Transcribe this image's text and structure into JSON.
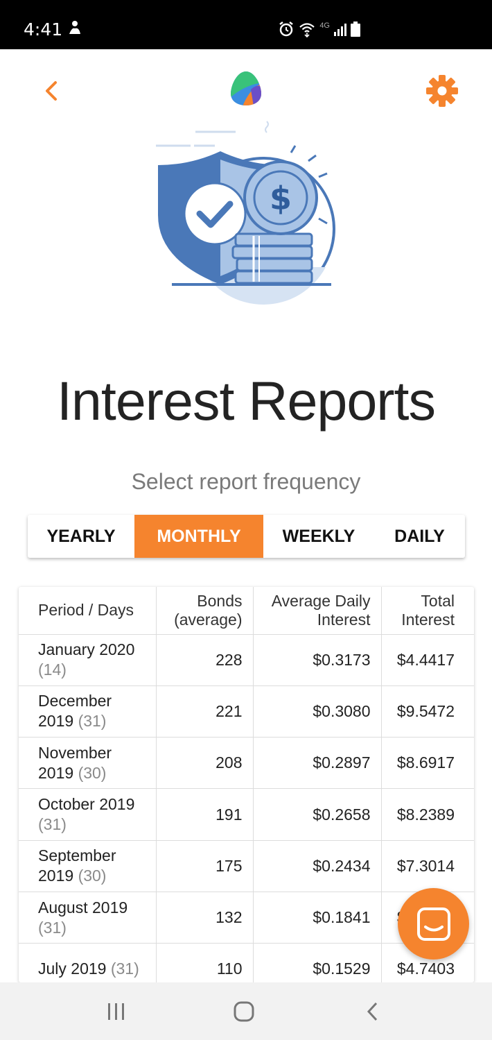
{
  "status_bar": {
    "time": "4:41",
    "network": "4G"
  },
  "header": {
    "back_icon": "chevron-left-icon",
    "logo_icon": "app-logo",
    "settings_icon": "gear-icon"
  },
  "page": {
    "title": "Interest Reports",
    "subtitle": "Select report frequency"
  },
  "frequency": {
    "options": [
      {
        "label": "YEARLY",
        "active": false
      },
      {
        "label": "MONTHLY",
        "active": true
      },
      {
        "label": "WEEKLY",
        "active": false
      },
      {
        "label": "DAILY",
        "active": false
      }
    ]
  },
  "table": {
    "headers": {
      "period": "Period / Days",
      "bonds": "Bonds (average)",
      "avg_interest": "Average Daily Interest",
      "total_interest": "Total Interest"
    },
    "rows": [
      {
        "period": "January 2020",
        "days": "(14)",
        "bonds": "228",
        "avg": "$0.3173",
        "total": "$4.4417"
      },
      {
        "period": "December 2019",
        "days": "(31)",
        "bonds": "221",
        "avg": "$0.3080",
        "total": "$9.5472"
      },
      {
        "period": "November 2019",
        "days": "(30)",
        "bonds": "208",
        "avg": "$0.2897",
        "total": "$8.6917"
      },
      {
        "period": "October 2019",
        "days": "(31)",
        "bonds": "191",
        "avg": "$0.2658",
        "total": "$8.2389"
      },
      {
        "period": "September 2019",
        "days": "(30)",
        "bonds": "175",
        "avg": "$0.2434",
        "total": "$7.3014"
      },
      {
        "period": "August 2019",
        "days": "(31)",
        "bonds": "132",
        "avg": "$0.1841",
        "total": "$5.7071"
      },
      {
        "period": "July 2019",
        "days": "(31)",
        "bonds": "110",
        "avg": "$0.1529",
        "total": "$4.7403"
      }
    ]
  },
  "colors": {
    "accent": "#f5842e",
    "illustration_blue": "#4a78b8",
    "illustration_light": "#a9c4e6"
  },
  "chat_button": {
    "icon": "chat-icon"
  },
  "nav_bar": {
    "icons": [
      "recent-apps-icon",
      "home-icon",
      "back-icon"
    ]
  }
}
